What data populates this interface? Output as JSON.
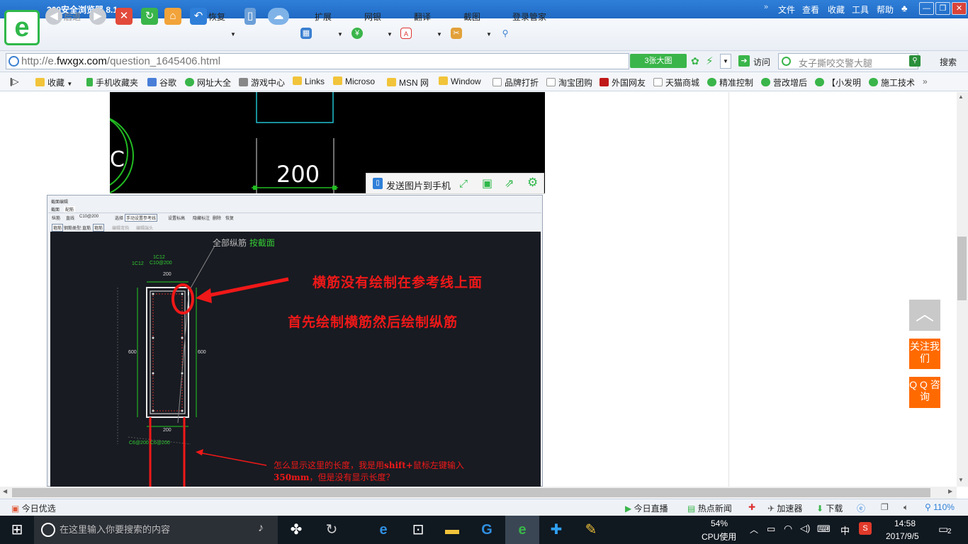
{
  "browser": {
    "title": "360安全浏览器 8.1",
    "menus": [
      "文件",
      "查看",
      "收藏",
      "工具",
      "帮助"
    ],
    "back_label": "后退",
    "restore_label": "恢复",
    "extend_label": "扩展",
    "bank_label": "网银",
    "translate_label": "翻译",
    "screenshot_label": "截图",
    "login_label": "登录管家",
    "url_prefix": "http://e.",
    "url_domain": "fwxgx.com",
    "url_path": "/question_1645406.html",
    "bigpic_label": "3张大图",
    "visit_label": "访问",
    "search_placeholder": "女子撕咬交警大腿",
    "search_label": "搜索"
  },
  "bookmarks": {
    "favorites": "收藏",
    "items": [
      "手机收藏夹",
      "谷歌",
      "网址大全",
      "游戏中心",
      "Links",
      "Microso",
      "MSN 网",
      "Window",
      "品牌打折",
      "淘宝团购",
      "外国网友",
      "天猫商城",
      "精准控制",
      "营改增后",
      "【小发明",
      "施工技术"
    ]
  },
  "cad_top": {
    "dimension": "200"
  },
  "send_to_phone": {
    "label": "发送图片到手机"
  },
  "cad_window": {
    "title": "截面编辑",
    "tabs": [
      "截面",
      "配筋"
    ],
    "toolbar1": [
      "纵筋",
      "直线",
      "C10@200",
      "选择",
      "手动设置参考线",
      "设置标高",
      "隐藏标注",
      "删除",
      "恢复"
    ],
    "toolbar2": [
      "箍筋",
      "钢筋类型:",
      "直筋",
      "箍筋",
      "编辑弯钩",
      "编辑端头"
    ],
    "hint_prefix": "全部纵筋",
    "hint_link": "按截面",
    "labels": {
      "top_1c12": "1C12",
      "top_c10": "C10@200",
      "left_1c12": "1C12",
      "width_top": "200",
      "height_left": "600",
      "height_right": "600",
      "width_bottom": "200",
      "bottom_1": "C6@200",
      "bottom_2": "C6@200"
    },
    "annotation1": "横筋没有绘制在参考线上面",
    "annotation2": "首先绘制横筋然后绘制纵筋",
    "question_line1_a": "怎么显示这里的长度，我是用",
    "question_line1_b": "shift+",
    "question_line1_c": "鼠标左键输入",
    "question_line2_a": "350mm",
    "question_line2_b": "，但是没有显示长度？"
  },
  "side": {
    "follow": "关注我们",
    "qq": "Q Q 咨询"
  },
  "status": {
    "today_pick": "今日优选",
    "live": "今日直播",
    "hot_news": "热点新闻",
    "accelerator": "加速器",
    "download": "下载",
    "zoom": "110%"
  },
  "taskbar": {
    "search_placeholder": "在这里输入你要搜索的内容",
    "cpu_percent": "54%",
    "cpu_label": "CPU使用",
    "ime": "中",
    "time": "14:58",
    "date": "2017/9/5",
    "notifications": "2"
  },
  "colors": {
    "accent_green": "#2fb84a",
    "titlebar_blue": "#1f6ac4",
    "annotation_red": "#e02020",
    "side_orange": "#ff6a00",
    "cad_green": "#33cc33"
  }
}
